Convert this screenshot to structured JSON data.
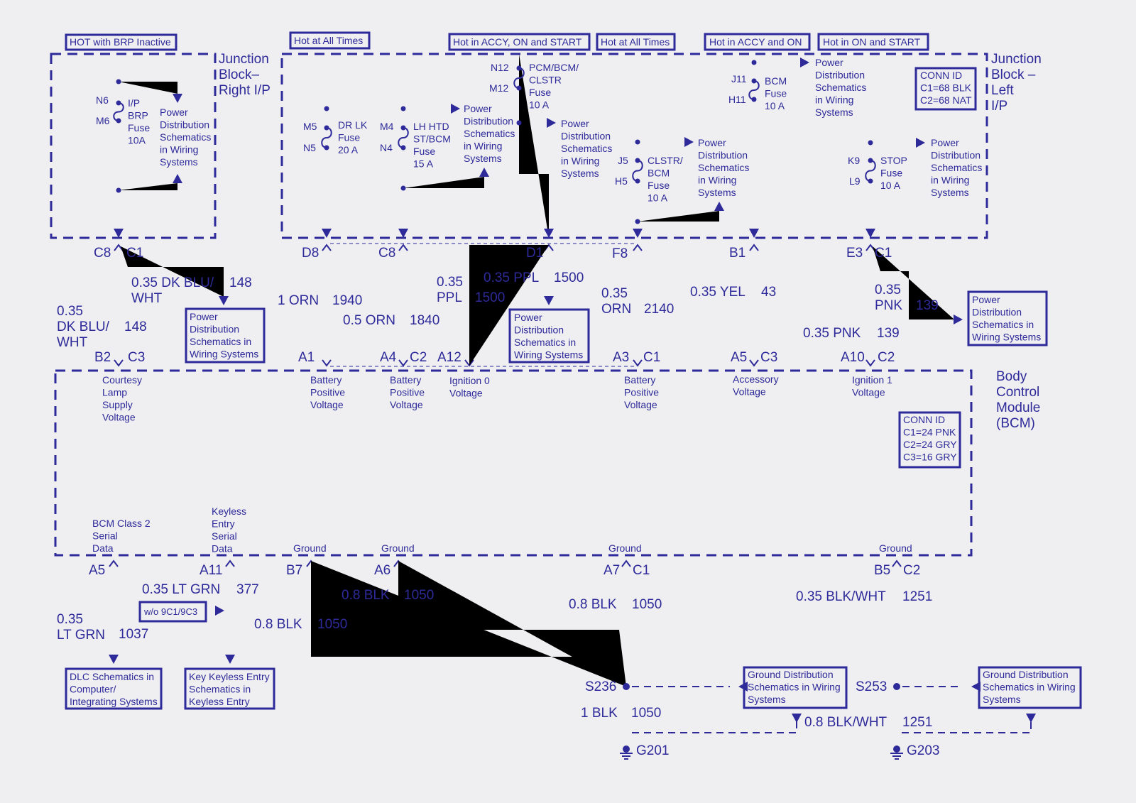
{
  "colors": {
    "ink": "#2e2a9a",
    "background": "#efeff1"
  },
  "labels": {
    "hdr_brp": [
      "HOT with BRP Inactive"
    ],
    "hdr_hot1": [
      "Hot at All Times"
    ],
    "hdr_accy_on_start": [
      "Hot in ACCY, ON and START"
    ],
    "hdr_hot2": [
      "Hot at All Times"
    ],
    "hdr_accy_on": [
      "Hot in ACCY and ON"
    ],
    "hdr_on_start": [
      "Hot in ON and START"
    ],
    "jb_right": [
      "Junction",
      "Block–",
      "Right I/P"
    ],
    "jb_left": [
      "Junction",
      "Block –",
      "Left",
      "I/P"
    ],
    "conn_jb": [
      "CONN ID",
      "C1=68 BLK",
      "C2=68 NAT"
    ],
    "n6": [
      "N6"
    ],
    "m6": [
      "M6"
    ],
    "fuse_brp": [
      "I/P",
      "BRP",
      "Fuse",
      "10A"
    ],
    "pd_brp": [
      "Power",
      "Distribution",
      "Schematics",
      "in Wiring",
      "Systems"
    ],
    "m5": [
      "M5"
    ],
    "n5": [
      "N5"
    ],
    "fuse_drlk": [
      "DR LK",
      "Fuse",
      "20 A"
    ],
    "pd_a": [
      "Power",
      "Distribution",
      "Schematics",
      "in Wiring",
      "Systems"
    ],
    "m4": [
      "M4"
    ],
    "n4": [
      "N4"
    ],
    "fuse_lhhtd": [
      "LH HTD",
      "ST/BCM",
      "Fuse",
      "15 A"
    ],
    "n12": [
      "N12"
    ],
    "m12": [
      "M12"
    ],
    "fuse_pcm": [
      "PCM/BCM/",
      "CLSTR",
      "Fuse",
      "10 A"
    ],
    "pd_b": [
      "Power",
      "Distribution",
      "Schematics",
      "in Wiring",
      "Systems"
    ],
    "pd_c": [
      "Power",
      "Distribution",
      "Schematics",
      "in Wiring",
      "Systems"
    ],
    "j5": [
      "J5"
    ],
    "h5": [
      "H5"
    ],
    "fuse_clstr": [
      "CLSTR/",
      "BCM",
      "Fuse",
      "10 A"
    ],
    "j11": [
      "J11"
    ],
    "h11": [
      "H11"
    ],
    "fuse_bcm": [
      "BCM",
      "Fuse",
      "10 A"
    ],
    "pd_d": [
      "Power",
      "Distribution",
      "Schematics",
      "in Wiring",
      "Systems"
    ],
    "k9": [
      "K9"
    ],
    "l9": [
      "L9"
    ],
    "fuse_stop": [
      "STOP",
      "Fuse",
      "10 A"
    ],
    "pd_e": [
      "Power",
      "Distribution",
      "Schematics",
      "in Wiring",
      "Systems"
    ],
    "c_c8a": [
      "C8"
    ],
    "c_c1a": [
      "C1"
    ],
    "c_d8": [
      "D8"
    ],
    "c_c8b": [
      "C8"
    ],
    "c_d1": [
      "D1"
    ],
    "c_f8": [
      "F8"
    ],
    "c_b1": [
      "B1"
    ],
    "c_e3": [
      "E3"
    ],
    "c_c1b": [
      "C1"
    ],
    "w148a": [
      "0.35 DK BLU/",
      "WHT"
    ],
    "n148a": [
      "148"
    ],
    "w148b": [
      "0.35",
      "DK BLU/",
      "WHT"
    ],
    "n148b": [
      "148"
    ],
    "box_pd1": [
      "Power",
      "Distribution",
      "Schematics in",
      "Wiring Systems"
    ],
    "w1940": [
      "1 ORN"
    ],
    "n1940": [
      "1940"
    ],
    "w1840": [
      "0.5 ORN"
    ],
    "n1840": [
      "1840"
    ],
    "w1500a": [
      "0.35 PPL"
    ],
    "n1500a": [
      "1500"
    ],
    "w1500b": [
      "0.35",
      "PPL"
    ],
    "n1500b": [
      "1500"
    ],
    "box_pd2": [
      "Power",
      "Distribution",
      "Schematics in",
      "Wiring Systems"
    ],
    "w2140": [
      "0.35",
      "ORN"
    ],
    "n2140": [
      "2140"
    ],
    "w43": [
      "0.35 YEL"
    ],
    "n43": [
      "43"
    ],
    "w139a": [
      "0.35",
      "PNK"
    ],
    "n139a": [
      "139"
    ],
    "w139b": [
      "0.35 PNK"
    ],
    "n139b": [
      "139"
    ],
    "box_pd3": [
      "Power",
      "Distribution",
      "Schematics in",
      "Wiring Systems"
    ],
    "c_b2": [
      "B2"
    ],
    "c_c3a": [
      "C3"
    ],
    "c_a1": [
      "A1"
    ],
    "c_a4": [
      "A4"
    ],
    "c_c2a": [
      "C2"
    ],
    "c_a12": [
      "A12"
    ],
    "c_a3": [
      "A3"
    ],
    "c_c1c": [
      "C1"
    ],
    "c_a5a": [
      "A5"
    ],
    "c_c3b": [
      "C3"
    ],
    "c_a10": [
      "A10"
    ],
    "c_c2b": [
      "C2"
    ],
    "bcm_title": [
      "Body",
      "Control",
      "Module",
      "(BCM)"
    ],
    "conn_bcm": [
      "CONN ID",
      "C1=24 PNK",
      "C2=24 GRY",
      "C3=16 GRY"
    ],
    "t_courtesy": [
      "Courtesy",
      "Lamp",
      "Supply",
      "Voltage"
    ],
    "t_batt1": [
      "Battery",
      "Positive",
      "Voltage"
    ],
    "t_batt2": [
      "Battery",
      "Positive",
      "Voltage"
    ],
    "t_ign0": [
      "Ignition 0",
      "Voltage"
    ],
    "t_batt3": [
      "Battery",
      "Positive",
      "Voltage"
    ],
    "t_acc": [
      "Accessory",
      "Voltage"
    ],
    "t_ign1": [
      "Ignition 1",
      "Voltage"
    ],
    "t_class2": [
      "BCM Class 2",
      "Serial",
      "Data"
    ],
    "t_keyless": [
      "Keyless",
      "Entry",
      "Serial",
      "Data"
    ],
    "t_gnd1": [
      "Ground"
    ],
    "t_gnd2": [
      "Ground"
    ],
    "t_gnd3": [
      "Ground"
    ],
    "t_gnd4": [
      "Ground"
    ],
    "c_a5b": [
      "A5"
    ],
    "c_a11": [
      "A11"
    ],
    "c_b7": [
      "B7"
    ],
    "c_a6": [
      "A6"
    ],
    "c_a7": [
      "A7"
    ],
    "c_c1d": [
      "C1"
    ],
    "c_b5": [
      "B5"
    ],
    "c_c2c": [
      "C2"
    ],
    "w377": [
      "0.35 LT GRN"
    ],
    "n377": [
      "377"
    ],
    "box_wo": [
      "w/o 9C1/9C3"
    ],
    "w1037": [
      "0.35",
      "LT GRN"
    ],
    "n1037": [
      "1037"
    ],
    "w1050a": [
      "0.8 BLK"
    ],
    "n1050a": [
      "1050"
    ],
    "w1050b": [
      "0.8 BLK"
    ],
    "n1050b": [
      "1050"
    ],
    "w1050c": [
      "0.8 BLK"
    ],
    "n1050c": [
      "1050"
    ],
    "w1251a": [
      "0.35 BLK/WHT"
    ],
    "n1251a": [
      "1251"
    ],
    "box_dlc": [
      "DLC Schematics in",
      "Computer/",
      "Integrating Systems"
    ],
    "box_key": [
      "Key Keyless Entry",
      "Schematics in",
      "Keyless Entry"
    ],
    "s236": [
      "S236"
    ],
    "box_gd1": [
      "Ground Distribution",
      "Schematics in Wiring",
      "Systems"
    ],
    "w1050d": [
      "1 BLK"
    ],
    "n1050d": [
      "1050"
    ],
    "w1251b": [
      "0.8 BLK/WHT"
    ],
    "n1251b": [
      "1251"
    ],
    "g201": [
      "G201"
    ],
    "s253": [
      "S253"
    ],
    "box_gd2": [
      "Ground Distribution",
      "Schematics in Wiring",
      "Systems"
    ],
    "g203": [
      "G203"
    ]
  }
}
